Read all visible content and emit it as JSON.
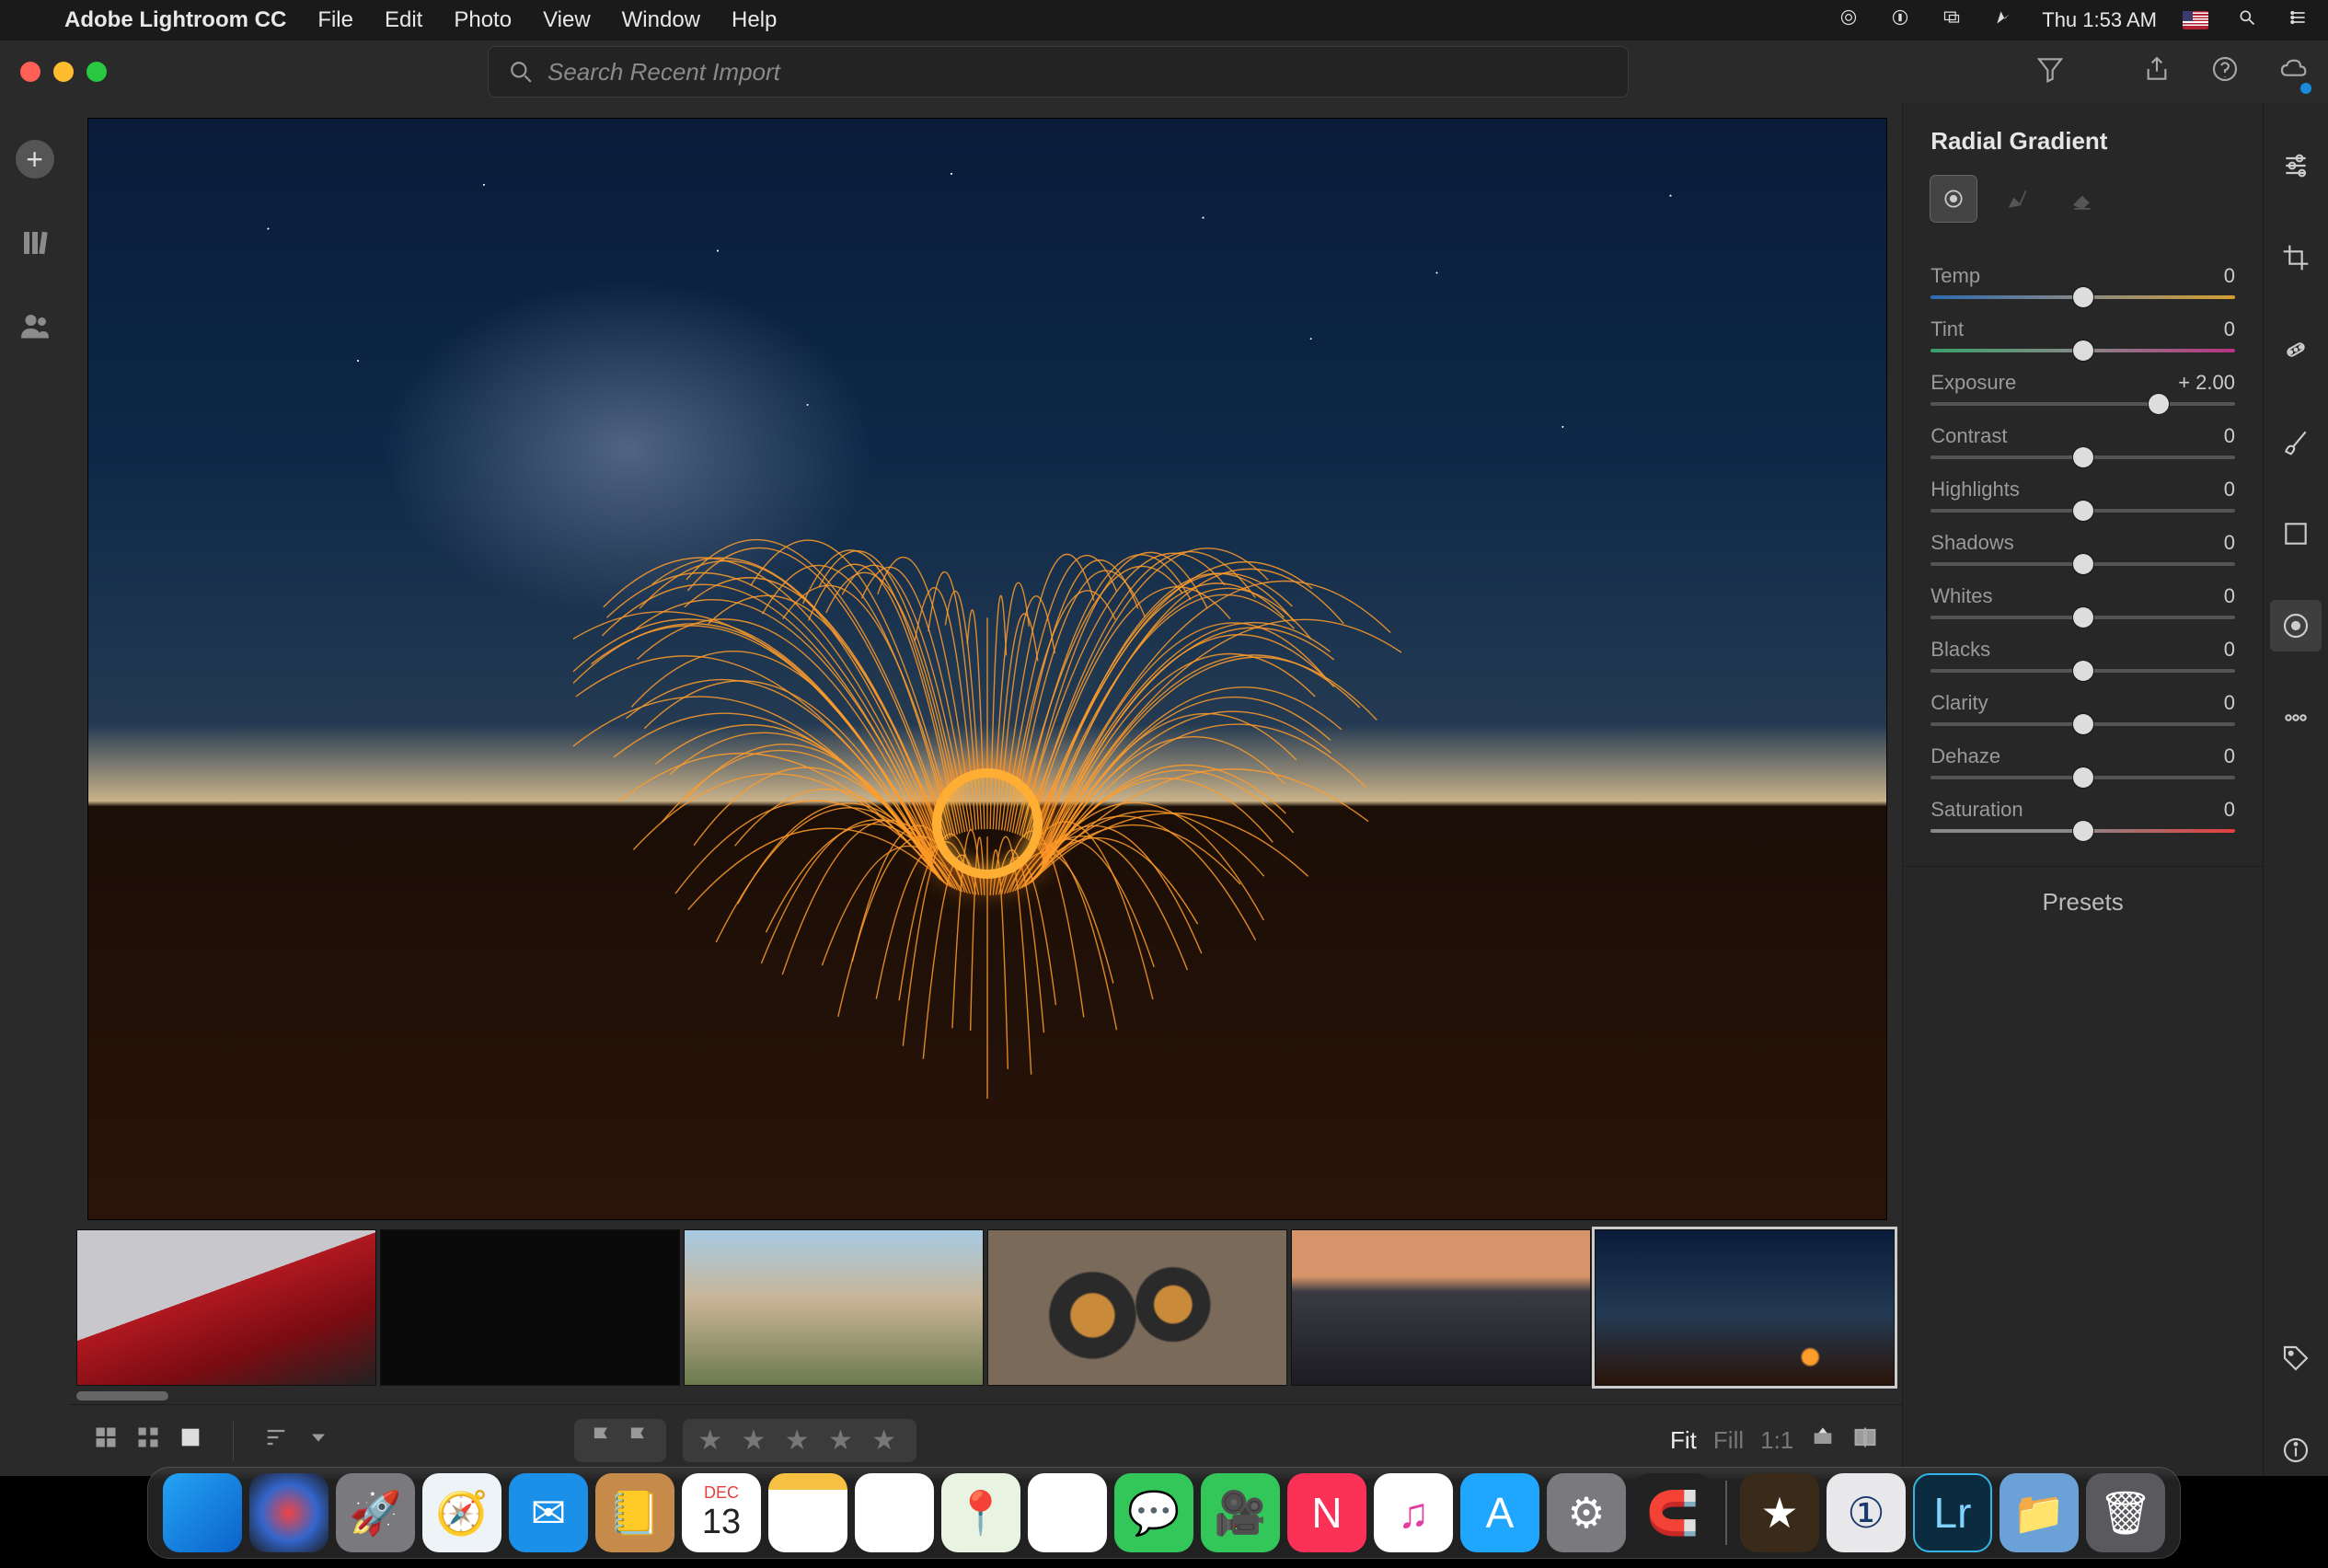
{
  "menubar": {
    "app_name": "Adobe Lightroom CC",
    "items": [
      "File",
      "Edit",
      "Photo",
      "View",
      "Window",
      "Help"
    ],
    "clock": "Thu 1:53 AM"
  },
  "search": {
    "placeholder": "Search Recent Import"
  },
  "panel": {
    "title": "Radial Gradient",
    "tools": {
      "radial": "radial-mask",
      "brush": "brush-mask",
      "eraser": "eraser-mask"
    },
    "sliders": [
      {
        "key": "temp",
        "label": "Temp",
        "value": "0",
        "pos": 50,
        "track": "tk-temp"
      },
      {
        "key": "tint",
        "label": "Tint",
        "value": "0",
        "pos": 50,
        "track": "tk-tint"
      },
      {
        "key": "exposure",
        "label": "Exposure",
        "value": "+ 2.00",
        "pos": 75,
        "track": "tk-plain"
      },
      {
        "key": "contrast",
        "label": "Contrast",
        "value": "0",
        "pos": 50,
        "track": "tk-plain"
      },
      {
        "key": "highlights",
        "label": "Highlights",
        "value": "0",
        "pos": 50,
        "track": "tk-plain"
      },
      {
        "key": "shadows",
        "label": "Shadows",
        "value": "0",
        "pos": 50,
        "track": "tk-plain"
      },
      {
        "key": "whites",
        "label": "Whites",
        "value": "0",
        "pos": 50,
        "track": "tk-plain"
      },
      {
        "key": "blacks",
        "label": "Blacks",
        "value": "0",
        "pos": 50,
        "track": "tk-plain"
      },
      {
        "key": "clarity",
        "label": "Clarity",
        "value": "0",
        "pos": 50,
        "track": "tk-plain"
      },
      {
        "key": "dehaze",
        "label": "Dehaze",
        "value": "0",
        "pos": 50,
        "track": "tk-plain"
      },
      {
        "key": "saturation",
        "label": "Saturation",
        "value": "0",
        "pos": 50,
        "track": "tk-sat"
      }
    ],
    "presets": "Presets"
  },
  "toolrail": {
    "tools": [
      "adjust",
      "crop",
      "heal",
      "brush",
      "linear",
      "radial",
      "more"
    ],
    "bottom": [
      "tag",
      "info"
    ]
  },
  "bottombar": {
    "fit": "Fit",
    "fill": "Fill",
    "ratio": "1:1"
  },
  "filmstrip": {
    "thumbs": [
      {
        "name": "thumb-car",
        "bg": "linear-gradient(160deg,#c8c8cc 0%,#c8c8cc 42%,#b01820 42%,#7a0c12 70%,#222 100%)"
      },
      {
        "name": "thumb-apple",
        "bg": "#0a0a0a"
      },
      {
        "name": "thumb-mountain",
        "bg": "linear-gradient(to bottom,#a8cbe4 0%,#c8b496 45%,#6b7a4e 100%)"
      },
      {
        "name": "thumb-coffee",
        "bg": "radial-gradient(circle at 35% 55%,#c98a3a 0%,#c98a3a 10%,#2a2a2a 11%,#2a2a2a 20%,transparent 21%),radial-gradient(circle at 62% 48%,#c98a3a 0%,#c98a3a 9%,#2a2a2a 10%,#2a2a2a 18%,transparent 19%),#7a6a5a"
      },
      {
        "name": "thumb-coast",
        "bg": "linear-gradient(to bottom,#d6946a 0%,#d6946a 30%,#3a3a42 40%,#1c1c22 100%)"
      },
      {
        "name": "thumb-sparks",
        "bg": "radial-gradient(circle at 72% 82%,#ff9c2a 0%,#ff9c2a 3%,transparent 4%),linear-gradient(to bottom,#0a1c3a 0%,#243a52 55%,#2a140a 100%)",
        "selected": true
      }
    ]
  },
  "dock": {
    "icons": [
      {
        "name": "finder",
        "cls": "di-finder",
        "glyph": ""
      },
      {
        "name": "siri",
        "cls": "di-siri",
        "glyph": ""
      },
      {
        "name": "launchpad",
        "cls": "di-launch",
        "glyph": "🚀"
      },
      {
        "name": "safari",
        "cls": "di-safari",
        "glyph": "🧭"
      },
      {
        "name": "mail",
        "cls": "di-mail",
        "glyph": "✉︎"
      },
      {
        "name": "contacts",
        "cls": "di-contacts",
        "glyph": "📒"
      },
      {
        "name": "calendar",
        "cls": "di-cal",
        "glyph": "",
        "cal_top": "DEC",
        "cal_num": "13"
      },
      {
        "name": "notes",
        "cls": "di-notes",
        "glyph": ""
      },
      {
        "name": "reminders",
        "cls": "di-rem",
        "glyph": "☑︎"
      },
      {
        "name": "maps",
        "cls": "di-maps",
        "glyph": "📍"
      },
      {
        "name": "photos",
        "cls": "di-photos",
        "glyph": "✿"
      },
      {
        "name": "messages",
        "cls": "di-msg",
        "glyph": "💬"
      },
      {
        "name": "facetime",
        "cls": "di-ft",
        "glyph": "🎥"
      },
      {
        "name": "news",
        "cls": "di-news",
        "glyph": "N"
      },
      {
        "name": "itunes",
        "cls": "di-itunes",
        "glyph": "♫"
      },
      {
        "name": "appstore",
        "cls": "di-appst",
        "glyph": "A"
      },
      {
        "name": "preferences",
        "cls": "di-pref",
        "glyph": "⚙︎"
      },
      {
        "name": "magnet",
        "cls": "di-magnet",
        "glyph": "🧲"
      }
    ],
    "after_sep": [
      {
        "name": "imovie",
        "cls": "di-imovie",
        "glyph": "★"
      },
      {
        "name": "1password",
        "cls": "di-1p",
        "glyph": "①"
      },
      {
        "name": "lightroom",
        "cls": "di-lr",
        "glyph": "Lr"
      },
      {
        "name": "downloads",
        "cls": "di-dl",
        "glyph": "📁"
      },
      {
        "name": "trash",
        "cls": "di-trash",
        "glyph": "🗑"
      }
    ]
  }
}
